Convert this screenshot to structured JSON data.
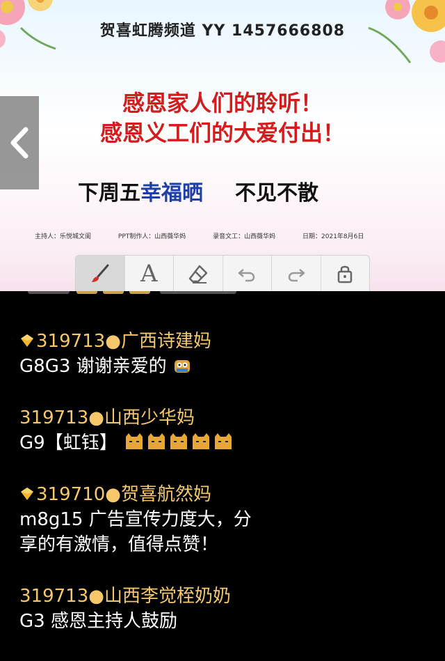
{
  "slide": {
    "channel_title": "贺喜虹腾频道  YY  1457666808",
    "headline_1": "感恩家人们的聆听！",
    "headline_2": "感恩义工们的大爱付出！",
    "bottom_part1": "下周五",
    "bottom_part2": "幸福晒",
    "bottom_part3": "不见不散",
    "credits": [
      "主持人：乐悦城文闺",
      "PPT制作人：山西薇华妈",
      "录音文工：山西薇华妈",
      "日期：2021年8月6日"
    ]
  },
  "toolbar": {
    "tools": [
      "brush-tool",
      "text-tool",
      "eraser-tool",
      "undo-tool",
      "redo-tool",
      "lock-tool"
    ],
    "text_tool_glyph": "A"
  },
  "colors": {
    "username": "#f6c86a",
    "message": "#ffffff",
    "headline_red": "#d41c1c",
    "accent_blue": "#1d3fa6",
    "chat_bg": "#000000"
  },
  "messages": [
    {
      "user": "319713●广西诗建妈",
      "text": "G8G3 谢谢亲爱的",
      "badge": true,
      "emoji": "owl-emoji"
    },
    {
      "user": "319713●山西少华妈",
      "text": "G9【虹钰】",
      "badge": false,
      "emoji": "cat-emoji-row"
    },
    {
      "user": "319710●贺喜航然妈",
      "text_lines": [
        "m8g15 广告宣传力度大，分",
        "享的有激情，值得点赞！"
      ],
      "badge": true
    },
    {
      "user": "319713●山西李觉桎奶奶",
      "text": "G3 感恩主持人鼓励",
      "badge": false
    }
  ]
}
